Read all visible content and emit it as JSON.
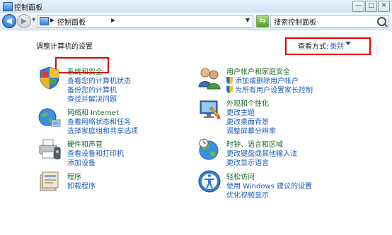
{
  "window": {
    "title": "控制面板",
    "minimize": "—",
    "maximize": "□",
    "close": "✕"
  },
  "addressbar": {
    "back": "◀",
    "forward": "▶",
    "recent": "▼",
    "separator": "▶",
    "path": "控制面板",
    "path_sep": "▶",
    "dropdown": "▼",
    "refresh": "⇆",
    "search_placeholder": "搜索控制面板"
  },
  "content": {
    "heading": "调整计算机的设置",
    "view_by_label": "查看方式:",
    "view_by_value": "类别"
  },
  "categories": [
    {
      "title": "系统和安全",
      "links": [
        "查看您的计算机状态",
        "备份您的计算机",
        "查找并解决问题"
      ],
      "icon": "shield-flag-icon"
    },
    {
      "title": "网络和 Internet",
      "links": [
        "查看网络状态和任务",
        "选择家庭组和共享选项"
      ],
      "icon": "globe-network-icon"
    },
    {
      "title": "硬件和声音",
      "links": [
        "查看设备和打印机",
        "添加设备"
      ],
      "icon": "printer-icon"
    },
    {
      "title": "程序",
      "links": [
        "卸载程序"
      ],
      "icon": "programs-icon"
    },
    {
      "title": "用户帐户和家庭安全",
      "links": [
        "添加或删除用户帐户",
        "为所有用户设置家长控制"
      ],
      "icon": "users-icon"
    },
    {
      "title": "外观和个性化",
      "links": [
        "更改主题",
        "更改桌面背景",
        "调整屏幕分辨率"
      ],
      "icon": "monitor-paint-icon"
    },
    {
      "title": "时钟、语言和区域",
      "links": [
        "更改键盘或其他输入法",
        "更改显示语言"
      ],
      "icon": "clock-globe-icon"
    },
    {
      "title": "轻松访问",
      "links": [
        "使用 Windows 建议的设置",
        "优化视频显示"
      ],
      "icon": "accessibility-icon"
    }
  ]
}
